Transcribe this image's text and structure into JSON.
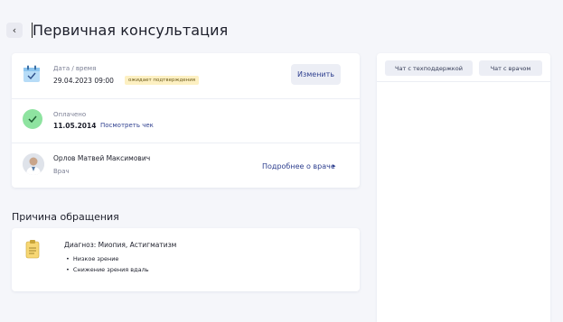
{
  "header": {
    "back_icon": "‹",
    "title": "Первичная консультация"
  },
  "appointment": {
    "date_label": "Дата / время",
    "date_value": "29.04.2023 09:00",
    "status_badge": "ожидает подтверждения",
    "edit_button": "Изменить"
  },
  "payment": {
    "label": "Оплачено",
    "date": "11.05.2014",
    "receipt_link": "Посмотреть чек"
  },
  "doctor": {
    "name": "Орлов Матвей Максимович",
    "role": "Врач",
    "more_link": "Подробнее о враче",
    "more_icon": "▸"
  },
  "reason": {
    "section_title": "Причина обращения",
    "diagnosis": "Диагноз: Миопия, Астигматизм",
    "items": [
      "Низкое зрение",
      "Снижение зрения вдаль"
    ]
  },
  "chat": {
    "support_button": "Чат с техподдержкой",
    "doctor_button": "Чат с врачом"
  },
  "colors": {
    "accent": "#2e3f8f",
    "badge_bg": "#fdf0c2",
    "paid_green": "#8ee3a0",
    "calendar_blue": "#b7dcf7",
    "clipboard_yellow": "#f7d774"
  }
}
